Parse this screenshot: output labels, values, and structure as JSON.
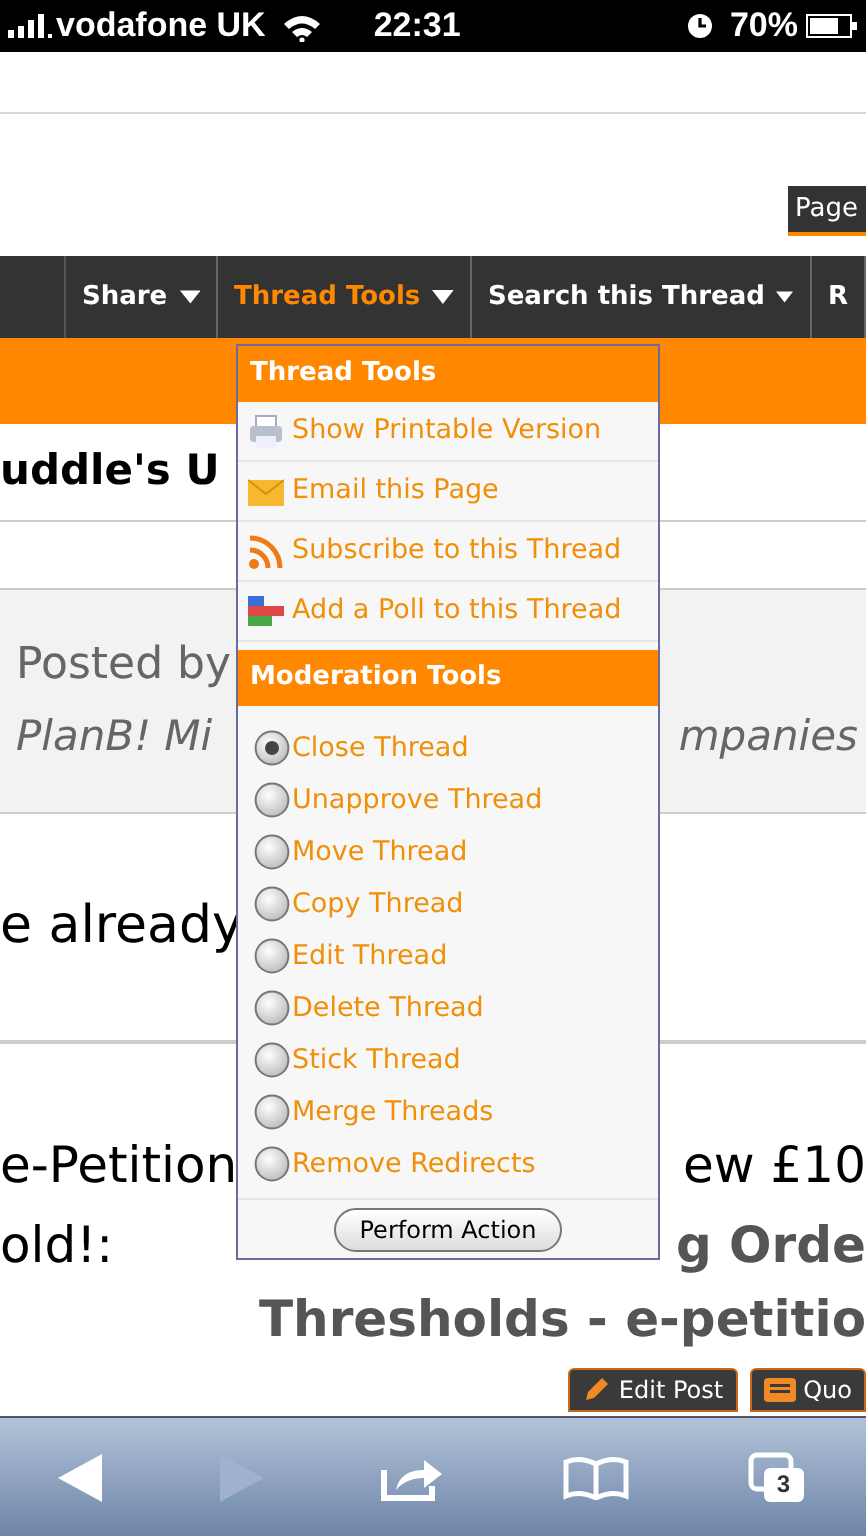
{
  "status_bar": {
    "carrier": "vodafone UK",
    "time": "22:31",
    "battery": "70%"
  },
  "page_tab": "Page",
  "nav": [
    {
      "label": "Share",
      "selected": false,
      "caret": true
    },
    {
      "label": "Thread Tools",
      "selected": true,
      "caret": true
    },
    {
      "label": "Search this Thread",
      "selected": false,
      "caret": true
    },
    {
      "label": "R",
      "selected": false,
      "caret": false
    }
  ],
  "thread_title": "uddle's U",
  "post_header": {
    "posted_by": "Posted by",
    "author_left": "PlanB! Mi",
    "author_right": "mpanies"
  },
  "post_line": "e already",
  "body_lines": [
    {
      "left": "e-Petition",
      "right": {
        "text": "ew £10",
        "kind": "plain"
      }
    },
    {
      "left": "old!:",
      "right": {
        "text": "g Orde",
        "kind": "link"
      }
    }
  ],
  "link_line": "Thresholds - e-petitio",
  "post_buttons": [
    {
      "kind": "edit",
      "label": "Edit Post"
    },
    {
      "kind": "quote",
      "label": "Quo"
    }
  ],
  "dropdown": {
    "title": "Thread Tools",
    "items": [
      {
        "kind": "print",
        "label": "Show Printable Version"
      },
      {
        "kind": "email",
        "label": "Email this Page"
      },
      {
        "kind": "rss",
        "label": "Subscribe to this Thread"
      },
      {
        "kind": "poll",
        "label": "Add a Poll to this Thread"
      }
    ],
    "moderation_title": "Moderation Tools",
    "options": [
      {
        "label": "Close Thread",
        "selected": true
      },
      {
        "label": "Unapprove Thread",
        "selected": false
      },
      {
        "label": "Move Thread",
        "selected": false
      },
      {
        "label": "Copy Thread",
        "selected": false
      },
      {
        "label": "Edit Thread",
        "selected": false
      },
      {
        "label": "Delete Thread",
        "selected": false
      },
      {
        "label": "Stick Thread",
        "selected": false
      },
      {
        "label": "Merge Threads",
        "selected": false
      },
      {
        "label": "Remove Redirects",
        "selected": false
      }
    ],
    "action_button": "Perform Action"
  },
  "toolbar": [
    {
      "kind": "back",
      "disabled": false
    },
    {
      "kind": "forward",
      "disabled": true
    },
    {
      "kind": "share",
      "disabled": false
    },
    {
      "kind": "bookmarks",
      "disabled": false
    },
    {
      "kind": "tabs",
      "disabled": false,
      "count": "3"
    }
  ]
}
